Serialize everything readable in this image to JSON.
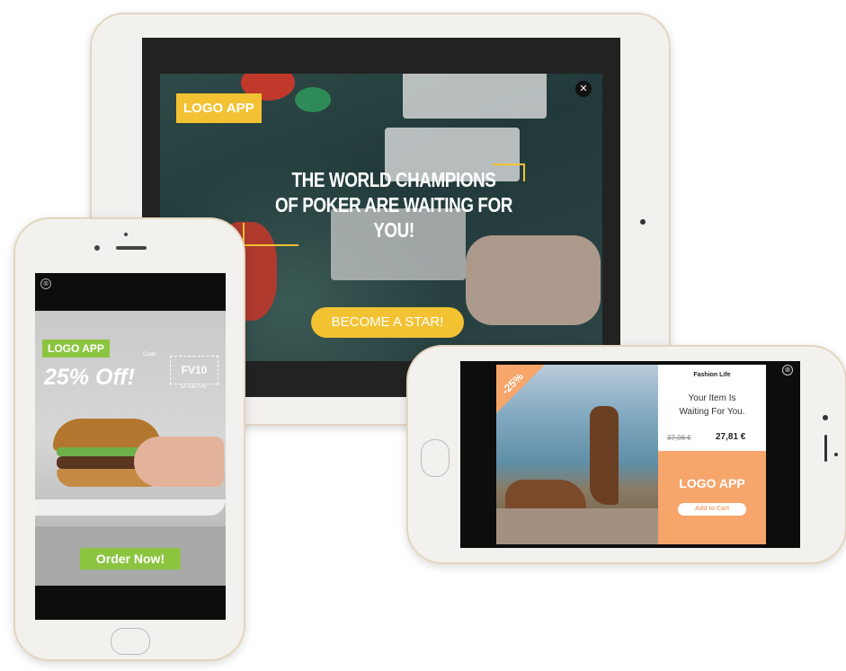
{
  "tablet": {
    "logo": "LOGO APP",
    "title_line1": "THE WORLD CHAMPIONS",
    "title_line2": "OF POKER ARE WAITING FOR YOU!",
    "cta": "BECOME A STAR!",
    "close": "✕",
    "accent_color": "#f2c233"
  },
  "portrait_phone": {
    "close": "⊗",
    "logo": "LOGO APP",
    "promo": "25% Off!",
    "code_label": "Code:",
    "code": "FV10",
    "code_note": "1st order only",
    "cta": "Order Now!",
    "accent_color": "#8bc540"
  },
  "landscape_phone": {
    "close": "⊗",
    "discount": "-25%",
    "brand": "Fashion Life",
    "message_line1": "Your Item Is",
    "message_line2": "Waiting For You.",
    "old_price": "37,06 €",
    "new_price": "27,81 €",
    "logo": "LOGO APP",
    "cta": "Add to Cart",
    "accent_color": "#f6a56b"
  }
}
